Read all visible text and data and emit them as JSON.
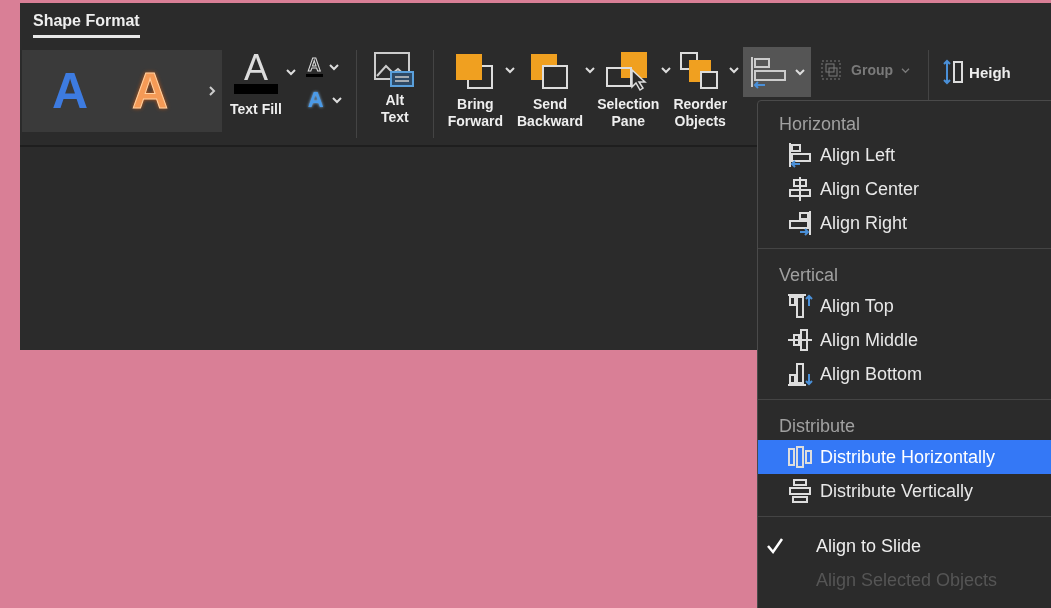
{
  "tabs": [
    {
      "label": "Shape Format",
      "selected": true
    }
  ],
  "style_gallery": [
    {
      "letter": "A",
      "kind": "blue"
    },
    {
      "letter": "A",
      "kind": "orange"
    }
  ],
  "text_fill": {
    "letter": "A",
    "label": "Text Fill"
  },
  "text_outline": {
    "letter": "A"
  },
  "text_effects": {
    "letter": "A"
  },
  "alt_text": {
    "lines": [
      "Alt",
      "Text"
    ]
  },
  "arrange_buttons": [
    {
      "kind": "bring-forward",
      "lines": [
        "Bring",
        "Forward"
      ]
    },
    {
      "kind": "send-backward",
      "lines": [
        "Send",
        "Backward"
      ]
    },
    {
      "kind": "selection-pane",
      "lines": [
        "Selection",
        "Pane"
      ]
    },
    {
      "kind": "reorder",
      "lines": [
        "Reorder",
        "Objects"
      ]
    }
  ],
  "align_button": {
    "selected": true
  },
  "group_button": {
    "label": "Group",
    "disabled": true
  },
  "height_field": {
    "label": "Heigh"
  },
  "align_menu": {
    "sections": [
      {
        "header": "Horizontal",
        "items": [
          {
            "kind": "align-left",
            "label": "Align Left",
            "selected": false
          },
          {
            "kind": "align-center",
            "label": "Align Center",
            "selected": false
          },
          {
            "kind": "align-right",
            "label": "Align Right",
            "selected": false
          }
        ]
      },
      {
        "header": "Vertical",
        "items": [
          {
            "kind": "align-top",
            "label": "Align Top",
            "selected": false
          },
          {
            "kind": "align-middle",
            "label": "Align Middle",
            "selected": false
          },
          {
            "kind": "align-bottom",
            "label": "Align Bottom",
            "selected": false
          }
        ]
      },
      {
        "header": "Distribute",
        "items": [
          {
            "kind": "distribute-h",
            "label": "Distribute Horizontally",
            "selected": true
          },
          {
            "kind": "distribute-v",
            "label": "Distribute Vertically",
            "selected": false
          }
        ]
      }
    ],
    "options": [
      {
        "label": "Align to Slide",
        "checked": true,
        "disabled": false
      },
      {
        "label": "Align Selected Objects",
        "checked": false,
        "disabled": true
      }
    ]
  }
}
